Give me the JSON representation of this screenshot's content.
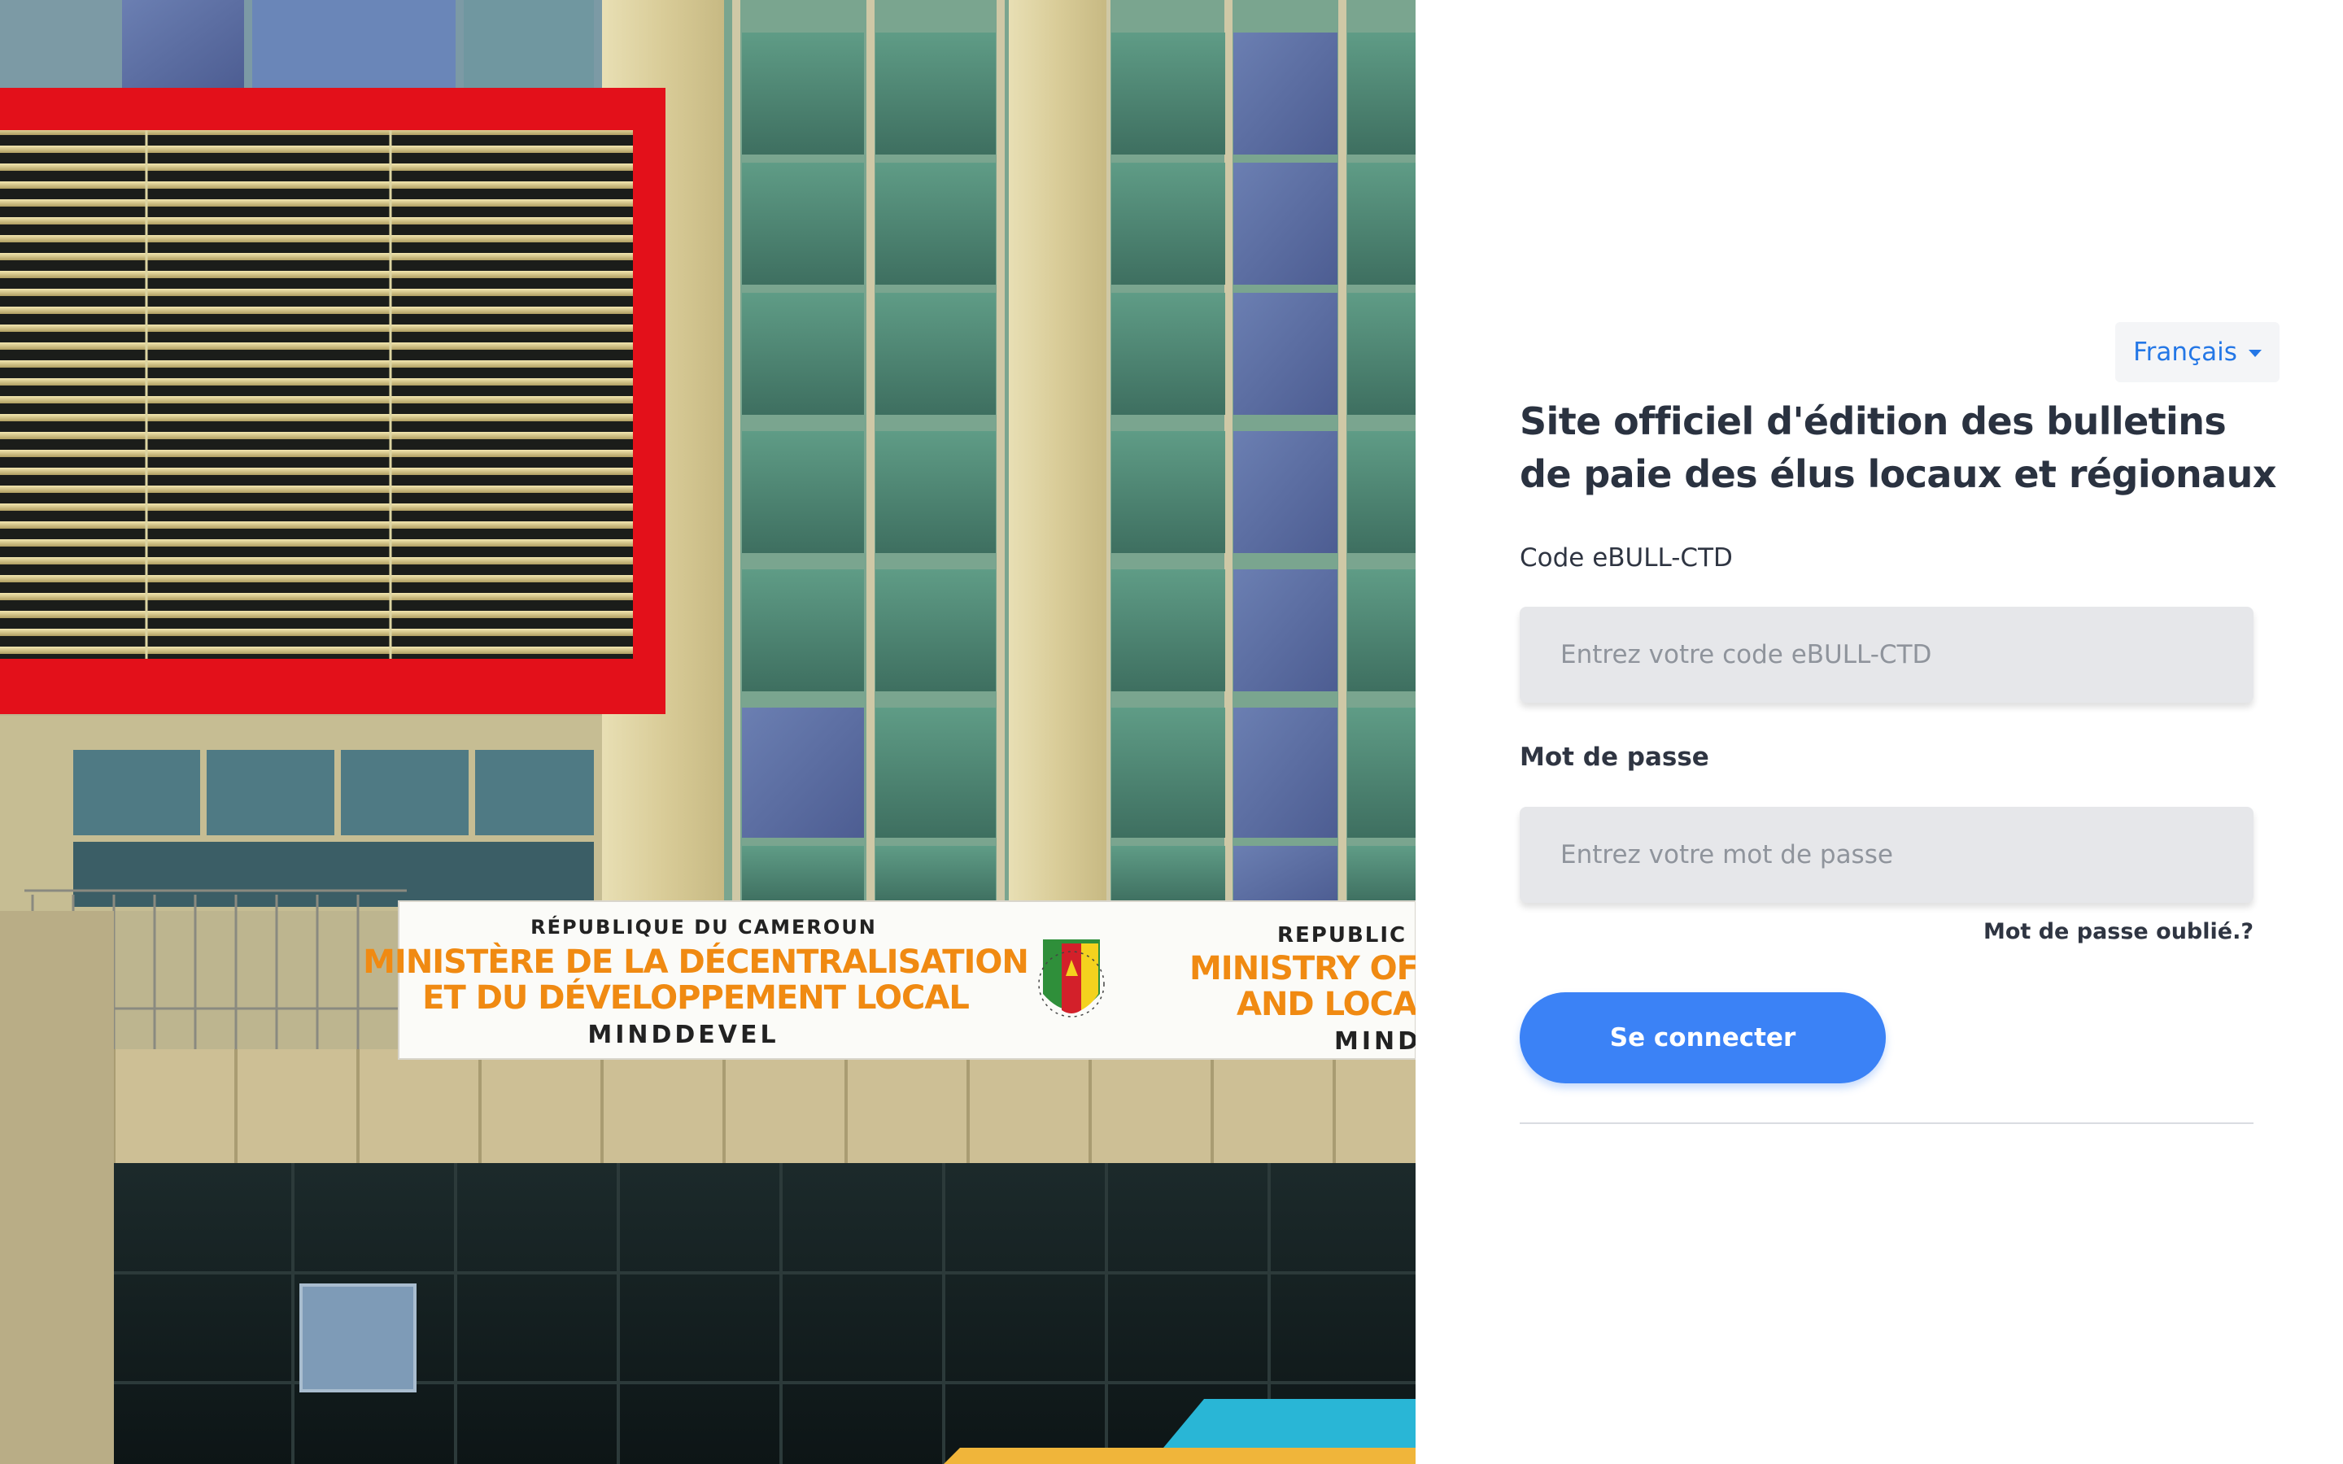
{
  "hero": {
    "sign_fr_line1": "RÉPUBLIQUE DU CAMEROUN",
    "sign_fr_line2": "MINISTÈRE DE LA DÉCENTRALISATION",
    "sign_fr_line3": "ET DU DÉVELOPPEMENT LOCAL",
    "sign_fr_line4": "MINDDEVEL",
    "sign_en_line1": "REPUBLIC O",
    "sign_en_line2": "MINISTRY OF DEC",
    "sign_en_line3": "AND LOCAL D",
    "sign_en_line4": "MIND",
    "colors": {
      "frame_red": "#e3101a",
      "sign_orange": "#f08a12"
    }
  },
  "header": {
    "language_label": "Français",
    "language_icon": "caret-down-icon"
  },
  "login": {
    "title": "Site officiel d'édition des bulletins de paie des élus locaux et régionaux",
    "code_label": "Code eBULL-CTD",
    "code_placeholder": "Entrez votre code eBULL-CTD",
    "password_label": "Mot de passe",
    "password_placeholder": "Entrez votre mot de passe",
    "forgot_label": "Mot de passe oublié.?",
    "submit_label": "Se connecter",
    "colors": {
      "accent": "#3b82f6",
      "link": "#2477e6"
    }
  }
}
